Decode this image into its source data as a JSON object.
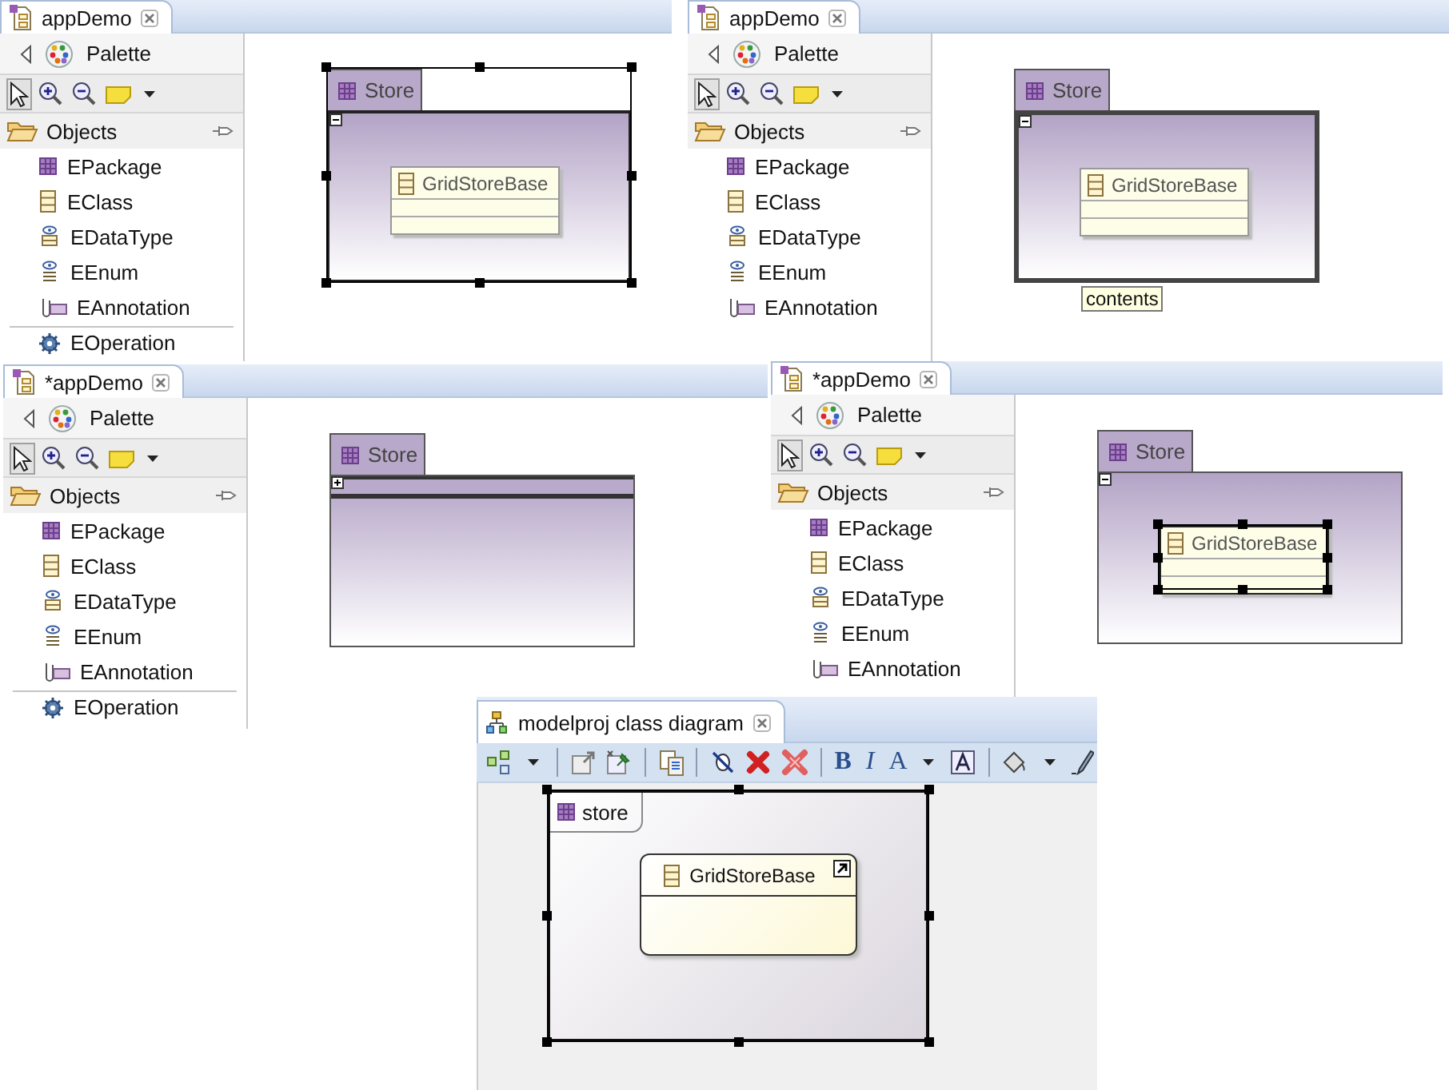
{
  "editors": [
    {
      "kind": "ecore",
      "tab": {
        "title": "appDemo"
      },
      "palette": {
        "title": "Palette",
        "tools": [
          {
            "kind": "select",
            "selected": true
          },
          {
            "kind": "zoom-in",
            "selected": false
          },
          {
            "kind": "zoom-out",
            "selected": false
          },
          {
            "kind": "note",
            "selected": false
          },
          {
            "kind": "menu",
            "selected": false
          }
        ],
        "drawer": {
          "label": "Objects",
          "expanded": true,
          "items": [
            {
              "kind": "epackage",
              "label": "EPackage"
            },
            {
              "kind": "eclass",
              "label": "EClass"
            },
            {
              "kind": "edatatype",
              "label": "EDataType"
            },
            {
              "kind": "eenum",
              "label": "EEnum"
            },
            {
              "kind": "eannotation",
              "label": "EAnnotation"
            },
            {
              "kind": "eoperation",
              "label": "EOperation"
            }
          ]
        }
      },
      "diagram": {
        "package": {
          "name": "Store",
          "selected": true,
          "highlighted": false,
          "collapsed": false,
          "classes": [
            {
              "name": "GridStoreBase",
              "selected": false
            }
          ]
        }
      }
    },
    {
      "kind": "ecore",
      "tab": {
        "title": "appDemo"
      },
      "palette": {
        "title": "Palette",
        "tools": [
          {
            "kind": "select",
            "selected": true
          },
          {
            "kind": "zoom-in",
            "selected": false
          },
          {
            "kind": "zoom-out",
            "selected": false
          },
          {
            "kind": "note",
            "selected": false
          },
          {
            "kind": "menu",
            "selected": false
          }
        ],
        "drawer": {
          "label": "Objects",
          "expanded": true,
          "items": [
            {
              "kind": "epackage",
              "label": "EPackage"
            },
            {
              "kind": "eclass",
              "label": "EClass"
            },
            {
              "kind": "edatatype",
              "label": "EDataType"
            },
            {
              "kind": "eenum",
              "label": "EEnum"
            },
            {
              "kind": "eannotation",
              "label": "EAnnotation"
            }
          ]
        }
      },
      "diagram": {
        "package": {
          "name": "Store",
          "selected": false,
          "highlighted": true,
          "collapsed": false,
          "tooltip": "contents",
          "classes": [
            {
              "name": "GridStoreBase",
              "selected": false
            }
          ]
        }
      }
    },
    {
      "kind": "ecore",
      "tab": {
        "title": "*appDemo"
      },
      "palette": {
        "title": "Palette",
        "tools": [
          {
            "kind": "select",
            "selected": true
          },
          {
            "kind": "zoom-in",
            "selected": false
          },
          {
            "kind": "zoom-out",
            "selected": false
          },
          {
            "kind": "note",
            "selected": false
          },
          {
            "kind": "menu",
            "selected": false
          }
        ],
        "drawer": {
          "label": "Objects",
          "expanded": true,
          "items": [
            {
              "kind": "epackage",
              "label": "EPackage"
            },
            {
              "kind": "eclass",
              "label": "EClass"
            },
            {
              "kind": "edatatype",
              "label": "EDataType"
            },
            {
              "kind": "eenum",
              "label": "EEnum"
            },
            {
              "kind": "eannotation",
              "label": "EAnnotation"
            },
            {
              "kind": "eoperation",
              "label": "EOperation"
            }
          ]
        }
      },
      "diagram": {
        "package": {
          "name": "Store",
          "selected": false,
          "highlighted": false,
          "collapsed": true
        }
      }
    },
    {
      "kind": "ecore",
      "tab": {
        "title": "*appDemo"
      },
      "palette": {
        "title": "Palette",
        "tools": [
          {
            "kind": "select",
            "selected": true
          },
          {
            "kind": "zoom-in",
            "selected": false
          },
          {
            "kind": "zoom-out",
            "selected": false
          },
          {
            "kind": "note",
            "selected": false
          },
          {
            "kind": "menu",
            "selected": false
          }
        ],
        "drawer": {
          "label": "Objects",
          "expanded": true,
          "items": [
            {
              "kind": "epackage",
              "label": "EPackage"
            },
            {
              "kind": "eclass",
              "label": "EClass"
            },
            {
              "kind": "edatatype",
              "label": "EDataType"
            },
            {
              "kind": "eenum",
              "label": "EEnum"
            },
            {
              "kind": "eannotation",
              "label": "EAnnotation"
            }
          ]
        }
      },
      "diagram": {
        "package": {
          "name": "Store",
          "selected": false,
          "highlighted": false,
          "collapsed": false,
          "classes": [
            {
              "name": "GridStoreBase",
              "selected": true
            }
          ]
        }
      }
    },
    {
      "kind": "classdiagram",
      "tab": {
        "title": "modelproj class diagram"
      },
      "toolbar": [
        {
          "kind": "arrange"
        },
        {
          "kind": "menu"
        },
        {
          "kind": "separator"
        },
        {
          "kind": "export"
        },
        {
          "kind": "pin"
        },
        {
          "kind": "separator"
        },
        {
          "kind": "copy"
        },
        {
          "kind": "separator"
        },
        {
          "kind": "hide"
        },
        {
          "kind": "delete"
        },
        {
          "kind": "delete-model"
        },
        {
          "kind": "separator"
        },
        {
          "kind": "bold",
          "label": "B"
        },
        {
          "kind": "italic",
          "label": "I"
        },
        {
          "kind": "font-color",
          "label": "A"
        },
        {
          "kind": "menu"
        },
        {
          "kind": "font"
        },
        {
          "kind": "separator"
        },
        {
          "kind": "fill"
        },
        {
          "kind": "menu"
        },
        {
          "kind": "line"
        }
      ],
      "diagram": {
        "package": {
          "name": "store",
          "selected": true,
          "classes": [
            {
              "name": "GridStoreBase",
              "shortcut": true
            }
          ]
        }
      }
    }
  ]
}
